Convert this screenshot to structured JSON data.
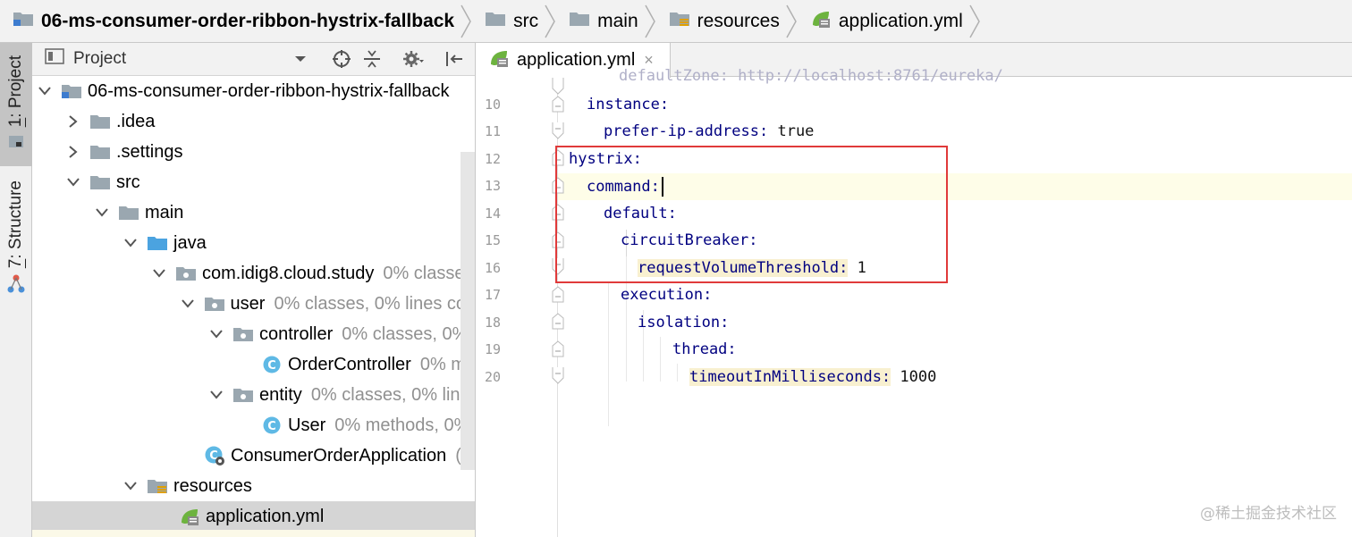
{
  "breadcrumb": [
    {
      "label": "06-ms-consumer-order-ribbon-hystrix-fallback",
      "icon": "module-folder-icon"
    },
    {
      "label": "src",
      "icon": "folder-icon"
    },
    {
      "label": "main",
      "icon": "folder-icon"
    },
    {
      "label": "resources",
      "icon": "resources-folder-icon"
    },
    {
      "label": "application.yml",
      "icon": "spring-yml-icon"
    }
  ],
  "tool_windows": {
    "project": {
      "number": "1",
      "label": ": Project"
    },
    "structure": {
      "number": "7",
      "label": ": Structure"
    }
  },
  "project_panel": {
    "title": "Project",
    "view_dropdown_icon": "chevron-down-icon",
    "actions": [
      "locate-icon",
      "collapse-all-icon",
      "gear-icon",
      "hide-icon"
    ],
    "tree": [
      {
        "name": "06-ms-consumer-order-ribbon-hystrix-fallback",
        "info": "",
        "icon": "module-folder-icon",
        "expanded": true
      },
      {
        "name": ".idea",
        "info": "",
        "icon": "folder-icon",
        "expanded": false
      },
      {
        "name": ".settings",
        "info": "",
        "icon": "folder-icon",
        "expanded": false
      },
      {
        "name": "src",
        "info": "",
        "icon": "folder-icon",
        "expanded": true
      },
      {
        "name": "main",
        "info": "",
        "icon": "folder-icon",
        "expanded": true
      },
      {
        "name": "java",
        "info": "",
        "icon": "source-folder-icon",
        "expanded": true
      },
      {
        "name": "com.idig8.cloud.study",
        "info": "0% classe",
        "icon": "package-icon",
        "expanded": true
      },
      {
        "name": "user",
        "info": "0% classes, 0% lines cov",
        "icon": "package-icon",
        "expanded": true
      },
      {
        "name": "controller",
        "info": "0% classes, 0%",
        "icon": "package-icon",
        "expanded": true
      },
      {
        "name": "OrderController",
        "info": "0% m",
        "icon": "class-icon",
        "expanded": null
      },
      {
        "name": "entity",
        "info": "0% classes, 0% line",
        "icon": "package-icon",
        "expanded": true
      },
      {
        "name": "User",
        "info": "0% methods, 0%",
        "icon": "class-icon",
        "expanded": null
      },
      {
        "name": "ConsumerOrderApplication",
        "info": "(",
        "icon": "spring-boot-class-icon",
        "expanded": null
      },
      {
        "name": "resources",
        "info": "",
        "icon": "resources-folder-icon",
        "expanded": true
      },
      {
        "name": "application.yml",
        "info": "",
        "icon": "spring-yml-icon",
        "expanded": null,
        "selected": true
      }
    ]
  },
  "editor": {
    "tab": {
      "label": "application.yml",
      "close": "×"
    },
    "lines": [
      {
        "n": "",
        "key": "defaultZone:",
        "value": " http://localhost:8761/eureka/"
      },
      {
        "n": "10",
        "key": "instance:",
        "value": ""
      },
      {
        "n": "11",
        "key": "prefer-ip-address:",
        "value": " true"
      },
      {
        "n": "12",
        "key": "hystrix:",
        "value": ""
      },
      {
        "n": "13",
        "key": "command:",
        "value": ""
      },
      {
        "n": "14",
        "key": "default:",
        "value": ""
      },
      {
        "n": "15",
        "key": "circuitBreaker:",
        "value": ""
      },
      {
        "n": "16",
        "key": "requestVolumeThreshold:",
        "value": " 1"
      },
      {
        "n": "17",
        "key": "execution:",
        "value": ""
      },
      {
        "n": "18",
        "key": "isolation:",
        "value": ""
      },
      {
        "n": "19",
        "key": "thread:",
        "value": ""
      },
      {
        "n": "20",
        "key": "timeoutInMilliseconds:",
        "value": " 1000"
      }
    ]
  },
  "watermark": "@稀土掘金技术社区"
}
